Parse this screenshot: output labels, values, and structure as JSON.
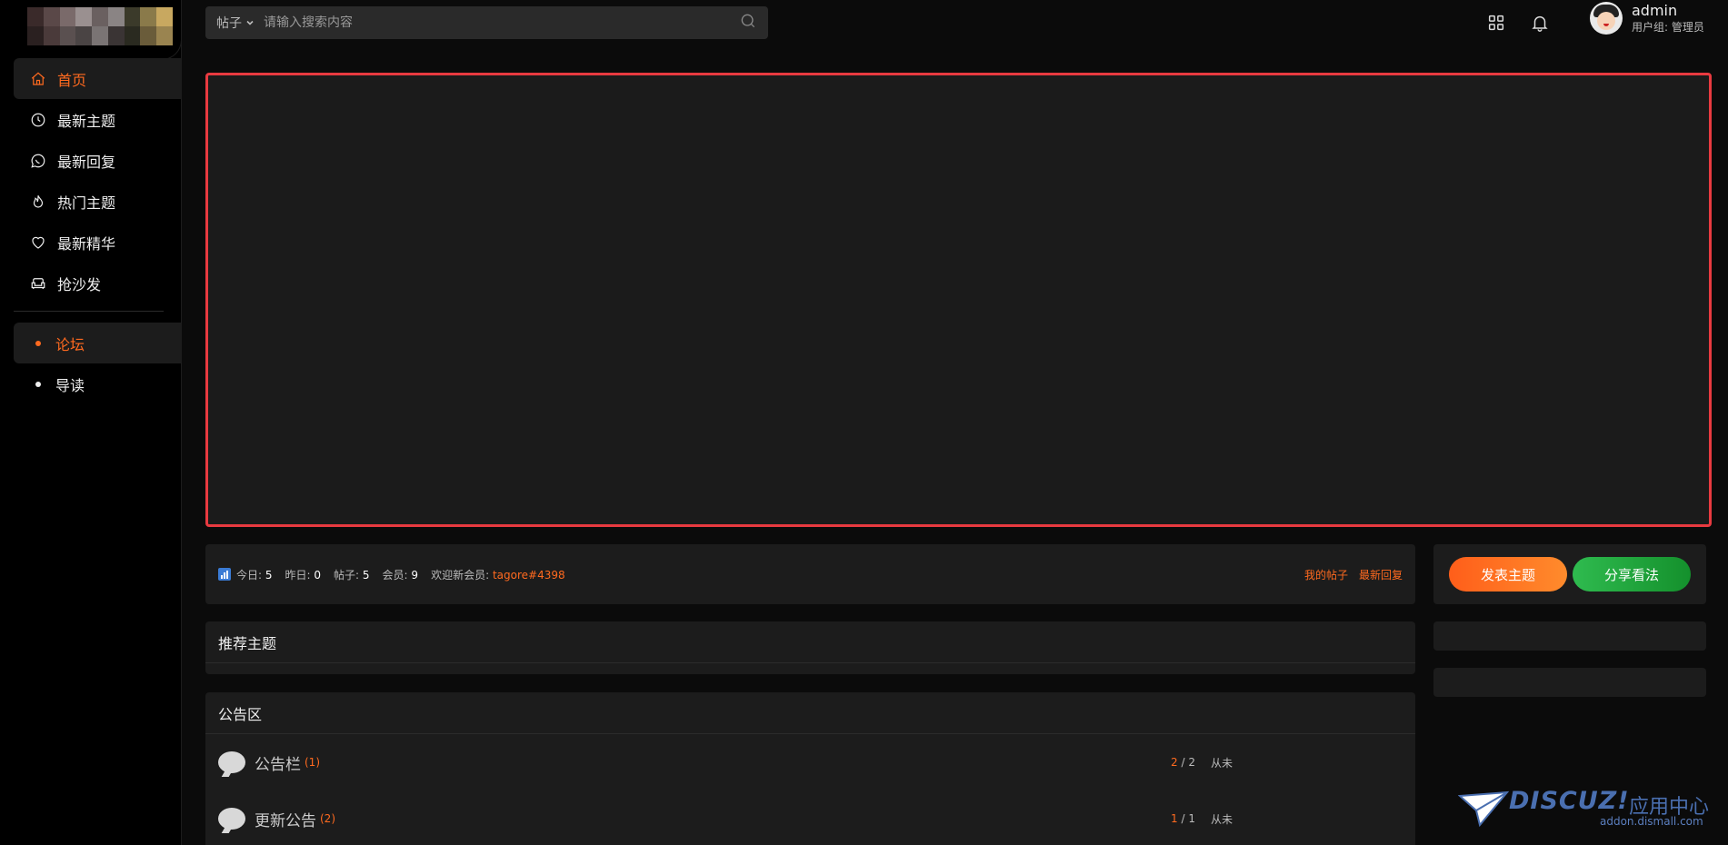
{
  "search": {
    "scope": "帖子",
    "placeholder": "请输入搜索内容"
  },
  "user": {
    "name": "admin",
    "group": "用户组: 管理员"
  },
  "sidebar": {
    "items": [
      {
        "label": "首页",
        "icon": "home-icon",
        "active": true
      },
      {
        "label": "最新主题",
        "icon": "clock-icon"
      },
      {
        "label": "最新回复",
        "icon": "chat-icon"
      },
      {
        "label": "热门主题",
        "icon": "flame-icon"
      },
      {
        "label": "最新精华",
        "icon": "heart-icon"
      },
      {
        "label": "抢沙发",
        "icon": "sofa-icon"
      }
    ],
    "sub_items": [
      {
        "label": "论坛",
        "active": true
      },
      {
        "label": "导读"
      }
    ]
  },
  "stats": {
    "today_label": "今日:",
    "today": "5",
    "yesterday_label": "昨日:",
    "yesterday": "0",
    "posts_label": "帖子:",
    "posts": "5",
    "members_label": "会员:",
    "members": "9",
    "new_member_label": "欢迎新会员:",
    "new_member": "tagore#4398",
    "my_posts": "我的帖子",
    "latest_replies": "最新回复"
  },
  "actions": {
    "post": "发表主题",
    "share": "分享看法"
  },
  "recommend": {
    "title": "推荐主题"
  },
  "announce": {
    "title": "公告区",
    "forums": [
      {
        "name": "公告栏",
        "count": "(1)",
        "ratio_hi": "2",
        "ratio_rest": " / 2",
        "last": "从未"
      },
      {
        "name": "更新公告",
        "count": "(2)",
        "ratio_hi": "1",
        "ratio_rest": " / 1",
        "last": "从未"
      }
    ]
  },
  "watermark": {
    "brand": "DISCUZ!",
    "cn": "应用中心",
    "url": "addon.dismall.com"
  },
  "colors": {
    "accent": "#ff6a1f",
    "banner_border": "#e83a40",
    "share_green": "#2fbb4f",
    "brand_blue": "#4a6fb0"
  }
}
